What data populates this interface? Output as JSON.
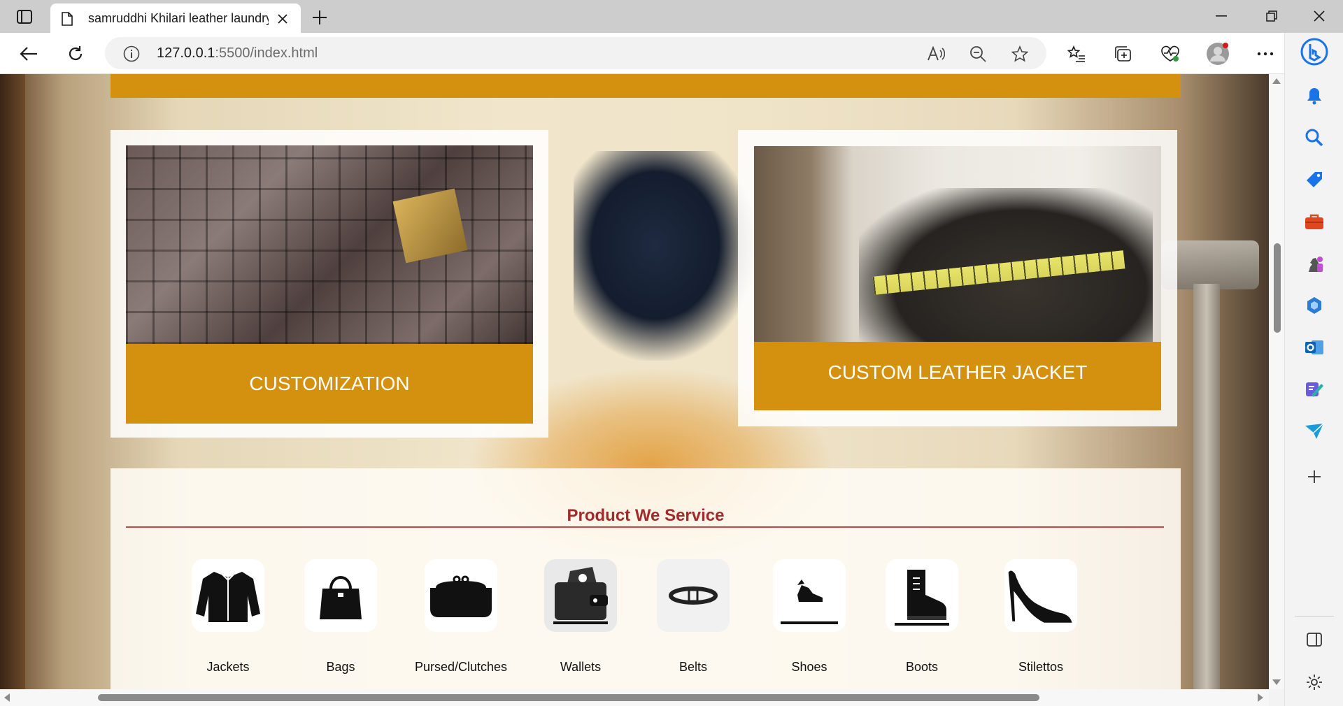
{
  "browser": {
    "tab_title": "samruddhi Khilari leather laundry",
    "url_host": "127.0.0.1",
    "url_path": ":5500/index.html"
  },
  "page": {
    "cards": [
      {
        "label": "CUSTOMIZATION"
      },
      {
        "label": "CUSTOM LEATHER JACKET"
      }
    ],
    "products_title": "Product We Service",
    "products": [
      {
        "label": "Jackets",
        "icon": "jacket-icon"
      },
      {
        "label": "Bags",
        "icon": "handbag-icon"
      },
      {
        "label": "Pursed/Clutches",
        "icon": "clutch-icon"
      },
      {
        "label": "Wallets",
        "icon": "wallet-icon"
      },
      {
        "label": "Belts",
        "icon": "belt-icon"
      },
      {
        "label": "Shoes",
        "icon": "shoe-icon"
      },
      {
        "label": "Boots",
        "icon": "boot-icon"
      },
      {
        "label": "Stilettos",
        "icon": "stiletto-icon"
      }
    ]
  },
  "colors": {
    "accent_gold": "#d4900f",
    "title_red": "#a32a2a",
    "edge_blue": "#1a73e8"
  },
  "sidebar_icons": [
    "bell-icon",
    "search-icon",
    "tag-icon",
    "briefcase-icon",
    "chess-icon",
    "copilot-icon",
    "outlook-icon",
    "designer-icon",
    "send-icon",
    "add-icon",
    "split-screen-icon",
    "settings-icon"
  ]
}
